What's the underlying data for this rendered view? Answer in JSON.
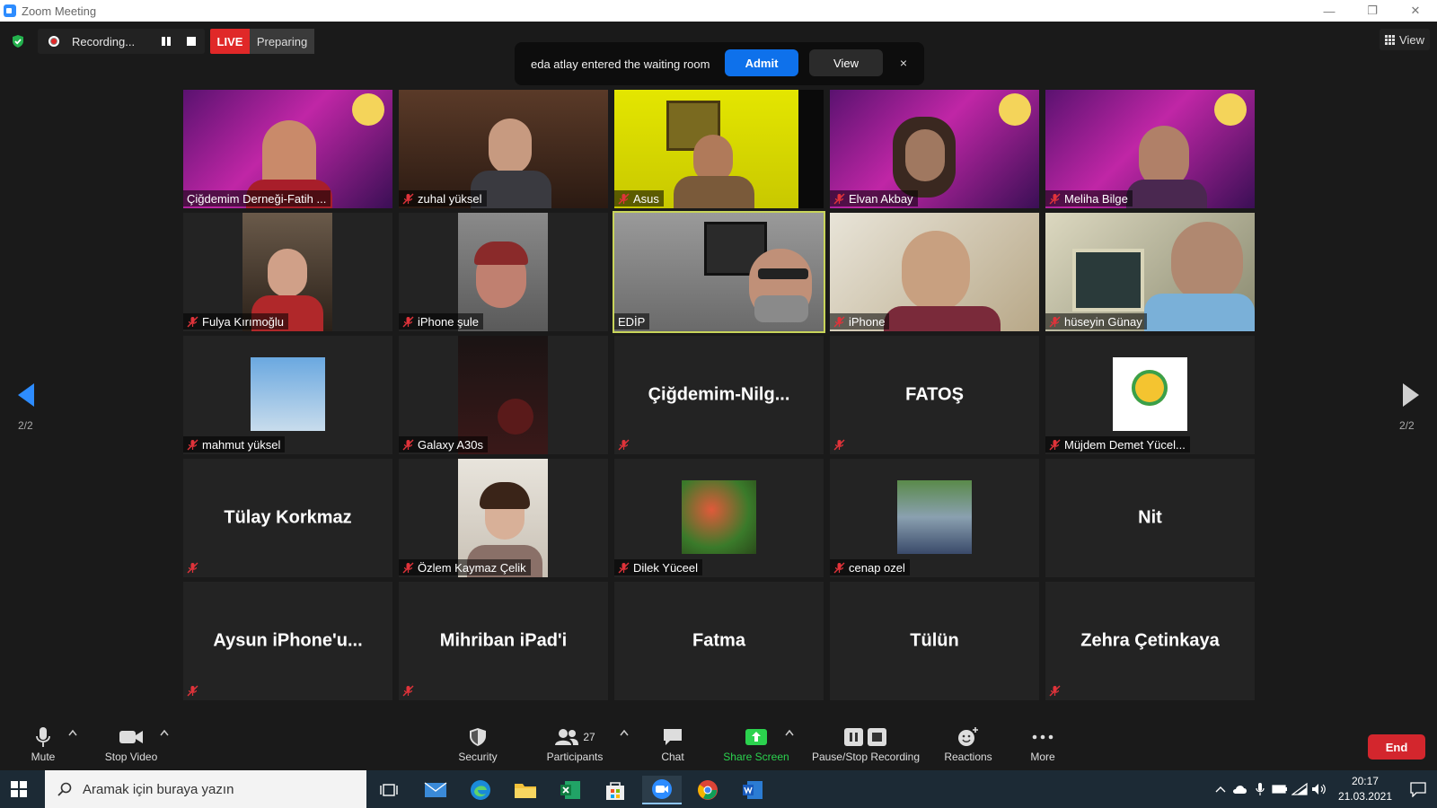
{
  "window": {
    "title": "Zoom Meeting"
  },
  "top": {
    "recording_label": "Recording...",
    "live_label": "LIVE",
    "preparing_label": "Preparing",
    "view_label": "View"
  },
  "notification": {
    "message": "eda atlay entered the waiting room",
    "admit_label": "Admit",
    "view_label": "View",
    "close_label": "×"
  },
  "pagination": {
    "left": "2/2",
    "right": "2/2"
  },
  "tiles": [
    {
      "label": "Çiğdemim Derneği-Fatih ...",
      "muted": false
    },
    {
      "label": "zuhal yüksel",
      "muted": true
    },
    {
      "label": "Asus",
      "muted": true
    },
    {
      "label": "Elvan Akbay",
      "muted": true
    },
    {
      "label": "Meliha Bilge",
      "muted": true
    },
    {
      "label": "Fulya Kırımoğlu",
      "muted": true
    },
    {
      "label": "iPhone şule",
      "muted": true
    },
    {
      "label": "EDİP",
      "muted": false
    },
    {
      "label": "iPhone",
      "muted": true
    },
    {
      "label": "hüseyin Günay",
      "muted": true
    },
    {
      "label": "mahmut yüksel",
      "muted": true
    },
    {
      "label": "Galaxy A30s",
      "muted": true
    },
    {
      "name": "Çiğdemim-Nilg...",
      "muted": true
    },
    {
      "name": "FATOŞ",
      "muted": true
    },
    {
      "label": "Müjdem Demet Yücel...",
      "muted": true
    },
    {
      "name": "Tülay Korkmaz",
      "muted": true
    },
    {
      "label": "Özlem Kaymaz Çelik",
      "muted": true
    },
    {
      "label": "Dilek Yüceel",
      "muted": true
    },
    {
      "label": "cenap ozel",
      "muted": true
    },
    {
      "name": "Nit",
      "muted": false
    },
    {
      "name": "Aysun iPhone'u...",
      "muted": true
    },
    {
      "name": "Mihriban iPad'i",
      "muted": true
    },
    {
      "name": "Fatma",
      "muted": false
    },
    {
      "name": "Tülün",
      "muted": false
    },
    {
      "name": "Zehra Çetinkaya",
      "muted": true
    }
  ],
  "toolbar": {
    "mute_label": "Mute",
    "stop_video_label": "Stop Video",
    "security_label": "Security",
    "participants_label": "Participants",
    "participants_count": "27",
    "chat_label": "Chat",
    "share_label": "Share Screen",
    "recording_label": "Pause/Stop Recording",
    "reactions_label": "Reactions",
    "more_label": "More",
    "end_label": "End"
  },
  "taskbar": {
    "search_placeholder": "Aramak için buraya yazın",
    "time": "20:17",
    "date": "21.03.2021"
  },
  "colors": {
    "accent_blue": "#0e71eb",
    "live_red": "#e02828",
    "end_red": "#d3262d",
    "share_green": "#2bd24e",
    "active_speaker": "#c8d45a"
  }
}
